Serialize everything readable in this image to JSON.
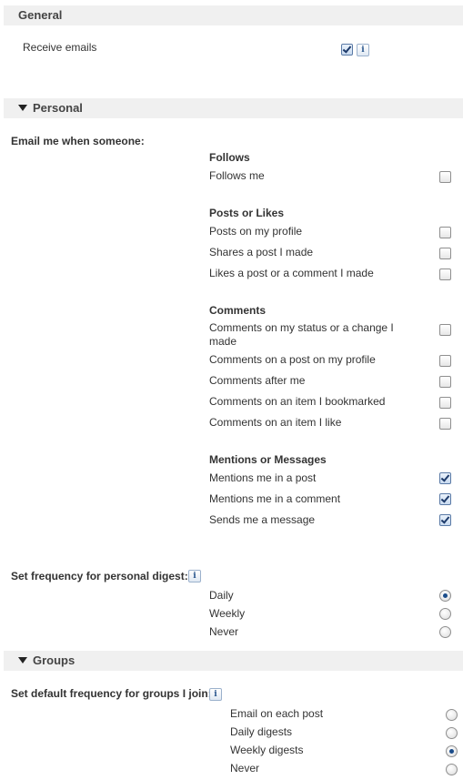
{
  "general": {
    "title": "General",
    "receive_emails": {
      "label": "Receive emails",
      "checked": true,
      "info_icon": "i"
    }
  },
  "personal": {
    "title": "Personal",
    "email_me_label": "Email me when someone:",
    "groups": [
      {
        "heading": "Follows",
        "items": [
          {
            "label": "Follows me",
            "checked": false
          }
        ]
      },
      {
        "heading": "Posts or Likes",
        "items": [
          {
            "label": "Posts on my profile",
            "checked": false
          },
          {
            "label": "Shares a post I made",
            "checked": false
          },
          {
            "label": "Likes a post or a comment I made",
            "checked": false
          }
        ]
      },
      {
        "heading": "Comments",
        "items": [
          {
            "label": "Comments on my status or a change I made",
            "checked": false
          },
          {
            "label": "Comments on a post on my profile",
            "checked": false
          },
          {
            "label": "Comments after me",
            "checked": false
          },
          {
            "label": "Comments on an item I bookmarked",
            "checked": false
          },
          {
            "label": "Comments on an item I like",
            "checked": false
          }
        ]
      },
      {
        "heading": "Mentions or Messages",
        "items": [
          {
            "label": "Mentions me in a post",
            "checked": true
          },
          {
            "label": "Mentions me in a comment",
            "checked": true
          },
          {
            "label": "Sends me a message",
            "checked": true
          }
        ]
      }
    ],
    "digest": {
      "label": "Set frequency for personal digest:",
      "info_icon": "i",
      "options": [
        {
          "label": "Daily",
          "selected": true
        },
        {
          "label": "Weekly",
          "selected": false
        },
        {
          "label": "Never",
          "selected": false
        }
      ]
    }
  },
  "groups": {
    "title": "Groups",
    "default_label": "Set default frequency for groups I join:",
    "info_icon": "i",
    "options": [
      {
        "label": "Email on each post",
        "selected": false
      },
      {
        "label": "Daily digests",
        "selected": false
      },
      {
        "label": "Weekly digests",
        "selected": true
      },
      {
        "label": "Never",
        "selected": false
      }
    ]
  }
}
